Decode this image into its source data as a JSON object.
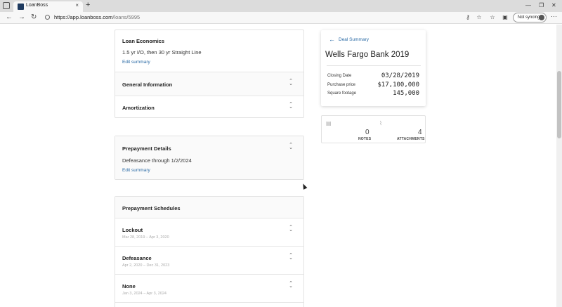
{
  "browser": {
    "tab_title": "LoanBoss",
    "tab_close": "×",
    "new_tab": "+",
    "url_host": "https://app.loanboss.com",
    "url_path": "/loans/5995",
    "sync_label": "Not syncing",
    "back": "←",
    "forward": "→",
    "reload": "↻",
    "minimize": "—",
    "maximize": "❐",
    "close": "✕",
    "menu": "···"
  },
  "loan_economics": {
    "title": "Loan Economics",
    "summary": "1.5 yr I/O, then 30 yr Straight Line",
    "edit": "Edit summary"
  },
  "general_information": {
    "title": "General Information"
  },
  "amortization": {
    "title": "Amortization"
  },
  "prepayment_details": {
    "title": "Prepayment Details",
    "summary": "Defeasance through 1/2/2024",
    "edit": "Edit summary"
  },
  "prepayment_schedules": {
    "title": "Prepayment Schedules",
    "items": [
      {
        "name": "Lockout",
        "range": "Mar 28, 2019 – Apr 3, 2020"
      },
      {
        "name": "Defeasance",
        "range": "Apr 2, 2020 – Dec 31, 2023"
      },
      {
        "name": "None",
        "range": "Jan 3, 2024 – Apr 3, 2024"
      }
    ]
  },
  "deal_summary": {
    "label": "Deal Summary",
    "name": "Wells Fargo Bank 2019",
    "fields": [
      {
        "key": "Closing Date",
        "value": "03/28/2019"
      },
      {
        "key": "Purchase price",
        "value": "$17,100,000"
      },
      {
        "key": "Square footage",
        "value": "145,000"
      }
    ]
  },
  "counters": {
    "notes_count": "0",
    "notes_label": "NOTES",
    "attachments_count": "4",
    "attachments_label": "ATTACHMENTS"
  },
  "colors": {
    "link": "#2a6aa5",
    "tab_favicon": "#1e3a5f"
  }
}
